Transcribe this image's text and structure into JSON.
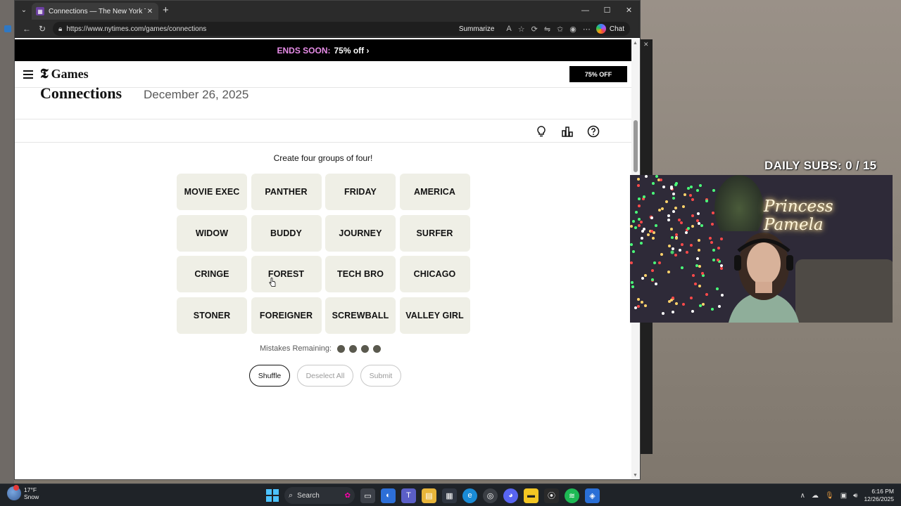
{
  "browser": {
    "tab_title": "Connections — The New York Tim",
    "url": "https://www.nytimes.com/games/connections",
    "summarize_label": "Summarize",
    "chat_label": "Chat"
  },
  "promo": {
    "ends_label": "ENDS SOON:",
    "offer_label": "75% off ›"
  },
  "header": {
    "logo_mark": "𝕿",
    "logo_text": "Games",
    "subscribe_label": "75% OFF"
  },
  "game": {
    "title": "Connections",
    "date": "December 26, 2025",
    "instructions": "Create four groups of four!",
    "tiles": [
      "MOVIE EXEC",
      "PANTHER",
      "FRIDAY",
      "AMERICA",
      "WIDOW",
      "BUDDY",
      "JOURNEY",
      "SURFER",
      "CRINGE",
      "FOREST",
      "TECH BRO",
      "CHICAGO",
      "STONER",
      "FOREIGNER",
      "SCREWBALL",
      "VALLEY GIRL"
    ],
    "mistakes_label": "Mistakes Remaining:",
    "mistakes_remaining": 4,
    "shuffle_label": "Shuffle",
    "deselect_label": "Deselect All",
    "submit_label": "Submit"
  },
  "overlay": {
    "subs_text": "DAILY SUBS:  0 / 15",
    "neon_sign": "Princess Pamela"
  },
  "taskbar": {
    "temperature": "17°F",
    "weather": "Snow",
    "search_label": "Search",
    "time": "6:16 PM",
    "date": "12/26/2025"
  },
  "colors": {
    "tile_bg": "#efefe6",
    "promo_accent": "#e88de8",
    "mistake_dot": "#5a594e"
  }
}
